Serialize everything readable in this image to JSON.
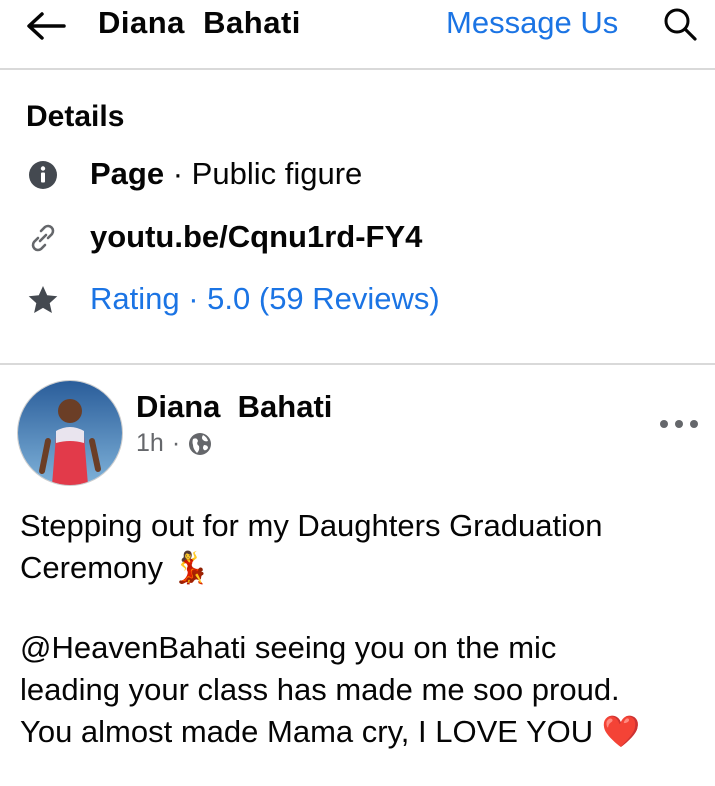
{
  "header": {
    "title": "Diana  Bahati",
    "message_label": "Message Us"
  },
  "details": {
    "title": "Details",
    "page_label": "Page",
    "page_sep": " · ",
    "page_category": "Public figure",
    "link": "youtu.be/Cqnu1rd-FY4",
    "rating": "Rating · 5.0 (59 Reviews)"
  },
  "post": {
    "author": "Diana  Bahati",
    "time": "1h",
    "dot": "·",
    "line1": "Stepping out for my Daughters Graduation",
    "line2": "Ceremony 💃",
    "line3": "@HeavenBahati seeing you on the mic",
    "line4": "leading your class has made me soo proud.",
    "line5": "You almost made Mama cry, I LOVE YOU ❤️"
  },
  "colors": {
    "accent": "#1b74e4",
    "secondary_text": "#65676b",
    "divider": "#d9d9d9"
  },
  "icons": [
    "back-arrow-icon",
    "search-icon",
    "info-icon",
    "link-icon",
    "star-icon",
    "globe-icon",
    "more-icon"
  ]
}
